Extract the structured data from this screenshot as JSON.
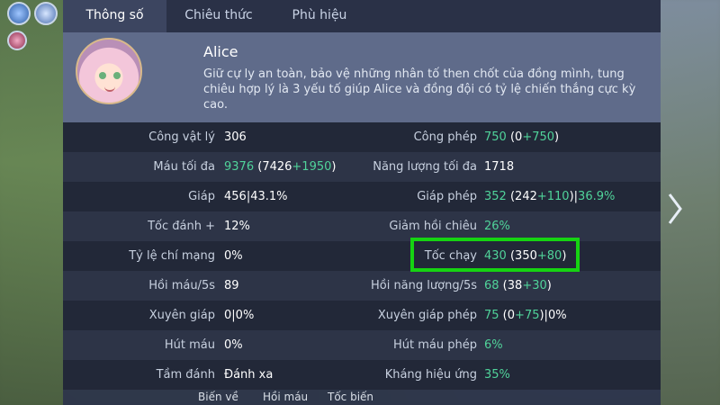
{
  "tabs": [
    "Thông số",
    "Chiêu thức",
    "Phù hiệu"
  ],
  "hero": {
    "name": "Alice",
    "description": "Giữ cự ly an toàn, bảo vệ những nhân tố then chốt của đồng mình, tung chiêu hợp lý là 3 yếu tố giúp Alice và đồng đội có tỷ lệ chiến thắng cực kỳ cao."
  },
  "stats_left": [
    {
      "label": "Công vật lý",
      "base": "306"
    },
    {
      "label": "Máu tối đa",
      "value": "9376",
      "paren_base": "7426",
      "bonus": "+1950"
    },
    {
      "label": "Giáp",
      "base": "456",
      "extra": "43.1%"
    },
    {
      "label": "Tốc đánh +",
      "base": "12%"
    },
    {
      "label": "Tỷ lệ chí mạng",
      "base": "0%"
    },
    {
      "label": "Hồi máu/5s",
      "base": "89"
    },
    {
      "label": "Xuyên giáp",
      "base": "0",
      "extra": "0%"
    },
    {
      "label": "Hút máu",
      "base": "0%"
    },
    {
      "label": "Tầm đánh",
      "base": "Đánh xa"
    }
  ],
  "stats_right": [
    {
      "label": "Công phép",
      "value": "750",
      "paren_base": "0",
      "bonus": "+750"
    },
    {
      "label": "Năng lượng tối đa",
      "base": "1718"
    },
    {
      "label": "Giáp phép",
      "value": "352",
      "paren_base": "242",
      "bonus": "+110",
      "extra_green": "36.9%"
    },
    {
      "label": "Giảm hồi chiêu",
      "value": "26%"
    },
    {
      "label": "Tốc chạy",
      "value": "430",
      "paren_base": "350",
      "bonus": "+80"
    },
    {
      "label": "Hồi năng lượng/5s",
      "value": "68",
      "paren_base": "38",
      "bonus": "+30"
    },
    {
      "label": "Xuyên giáp phép",
      "value": "75",
      "paren_base": "0",
      "bonus": "+75",
      "extra": "0%"
    },
    {
      "label": "Hút máu phép",
      "value": "6%"
    },
    {
      "label": "Kháng hiệu ứng",
      "value": "35%"
    }
  ],
  "bottom_labels": [
    "Biến về",
    "Hồi máu",
    "Tốc biến"
  ],
  "colors": {
    "bonus": "#50d39a",
    "highlight_border": "#16d312",
    "panel": "#2c344a"
  }
}
